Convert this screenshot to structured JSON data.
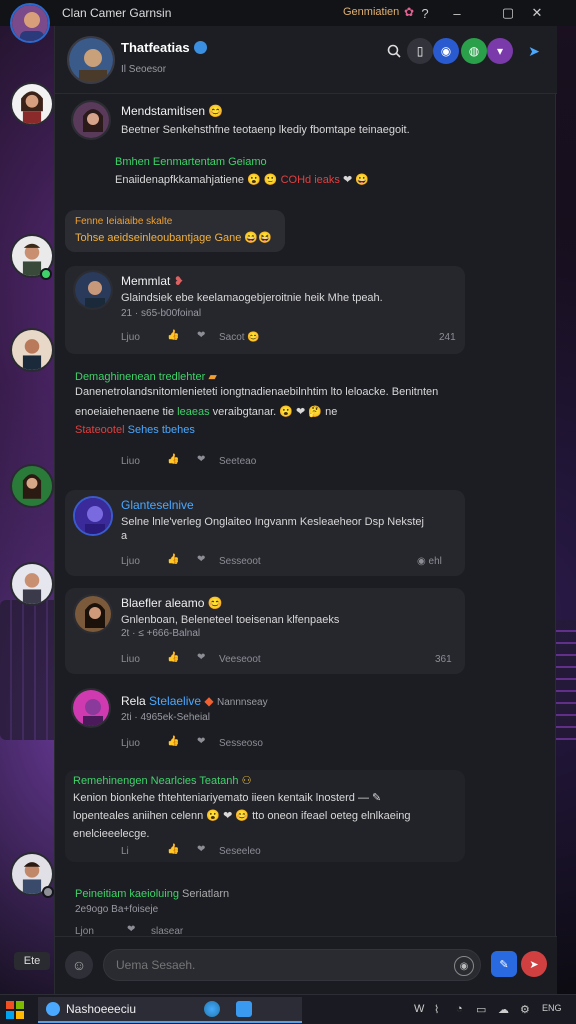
{
  "window": {
    "title": "Clan Camer Garnsin",
    "right_label": "Genmiatien",
    "controls": [
      "?",
      "–",
      "▢",
      "✕"
    ]
  },
  "header": {
    "name": "Thatfeatias",
    "subtitle": "Il Seoesor"
  },
  "messages": [
    {
      "name": "Mendstamitisen",
      "text": "Beetner Senkehsthfne teotaenp lkediy fbomtape teinaegoit."
    },
    {
      "name": "Bmhen Eenmartentam Geiamo",
      "text": "Enaiidenapfkkamahjatiene",
      "tail": "COHd ieaks"
    },
    {
      "name": "Fenne Ieiaiaibe skalte",
      "text": "Tohse aeidseinleoubantjage Gane"
    },
    {
      "name": "Memmlat",
      "text": "Glaindsiek ebe keelamaogebjeroitnie heik Mhe tpeah.",
      "meta": "21 · s65-b00foinal",
      "actions": [
        "Ljuo",
        "Sacot"
      ],
      "right": "241"
    },
    {
      "name": "Demaghinenean tredlehter",
      "text": "Danenetrolandsnitomlenieteti iongtnadienaebilnhtim lto leloacke. Benitnten",
      "text2": "enoeiaiehenaene tie",
      "text2b": "leaeas",
      "text2c": "veraibgtanar.",
      "text3": "Stateootel",
      "text3b": "Sehes tbehes",
      "actions": [
        "Liuo",
        "Seeteao"
      ]
    },
    {
      "name": "Glanteselnive",
      "text": "Selne lnle'verleg Onglaiteo Ingvanm Kesleaeheor Dsp Nekstej",
      "text_b": "a",
      "actions": [
        "Ljuo",
        "Sesseoot"
      ],
      "right": "ehl"
    },
    {
      "name": "Blaefler aleamo",
      "text": "Gnlenboan, Beleneteel toeisenan klfenpaeks",
      "meta": "2t · ≤ +666-Balnal",
      "actions": [
        "Liuo",
        "Veeseoot"
      ],
      "right": "361"
    },
    {
      "name": "Rela",
      "name_b": "Stelaelive",
      "name_c": "Nannnseay",
      "meta": "2ti · 4965ek-Seheial",
      "actions": [
        "Ljuo",
        "Sesseoso"
      ]
    },
    {
      "name": "Remehinengen Nearlcies Teatanh",
      "text": "Kenion bionkehe thtehteniariyemato iieen kentaik lnosterd",
      "text2": "lopenteales aniihen celenn",
      "text2b": "tto oneon ifeael oeteg elnlkaeing",
      "text3": "enelcieeelecge.",
      "actions": [
        "Li",
        "Seseeleo"
      ]
    },
    {
      "name": "Peineitiam kaeioluing",
      "name_b": "Seriatlarn",
      "meta": "2e9ogo Ba+foiseje",
      "actions": [
        "Ljon",
        "slasear"
      ]
    }
  ],
  "input": {
    "placeholder": "Uema Sesaeh."
  },
  "taskbar": {
    "app_label": "Nashoeeeciu",
    "tray": [
      "W",
      "ENG"
    ],
    "float_tag": "Ete"
  },
  "colors": {
    "green": "#3fd26a",
    "orange": "#f0a030",
    "blue": "#4aa8ff",
    "red": "#e04040",
    "panel": "#1c1d22",
    "card": "#26272d"
  }
}
